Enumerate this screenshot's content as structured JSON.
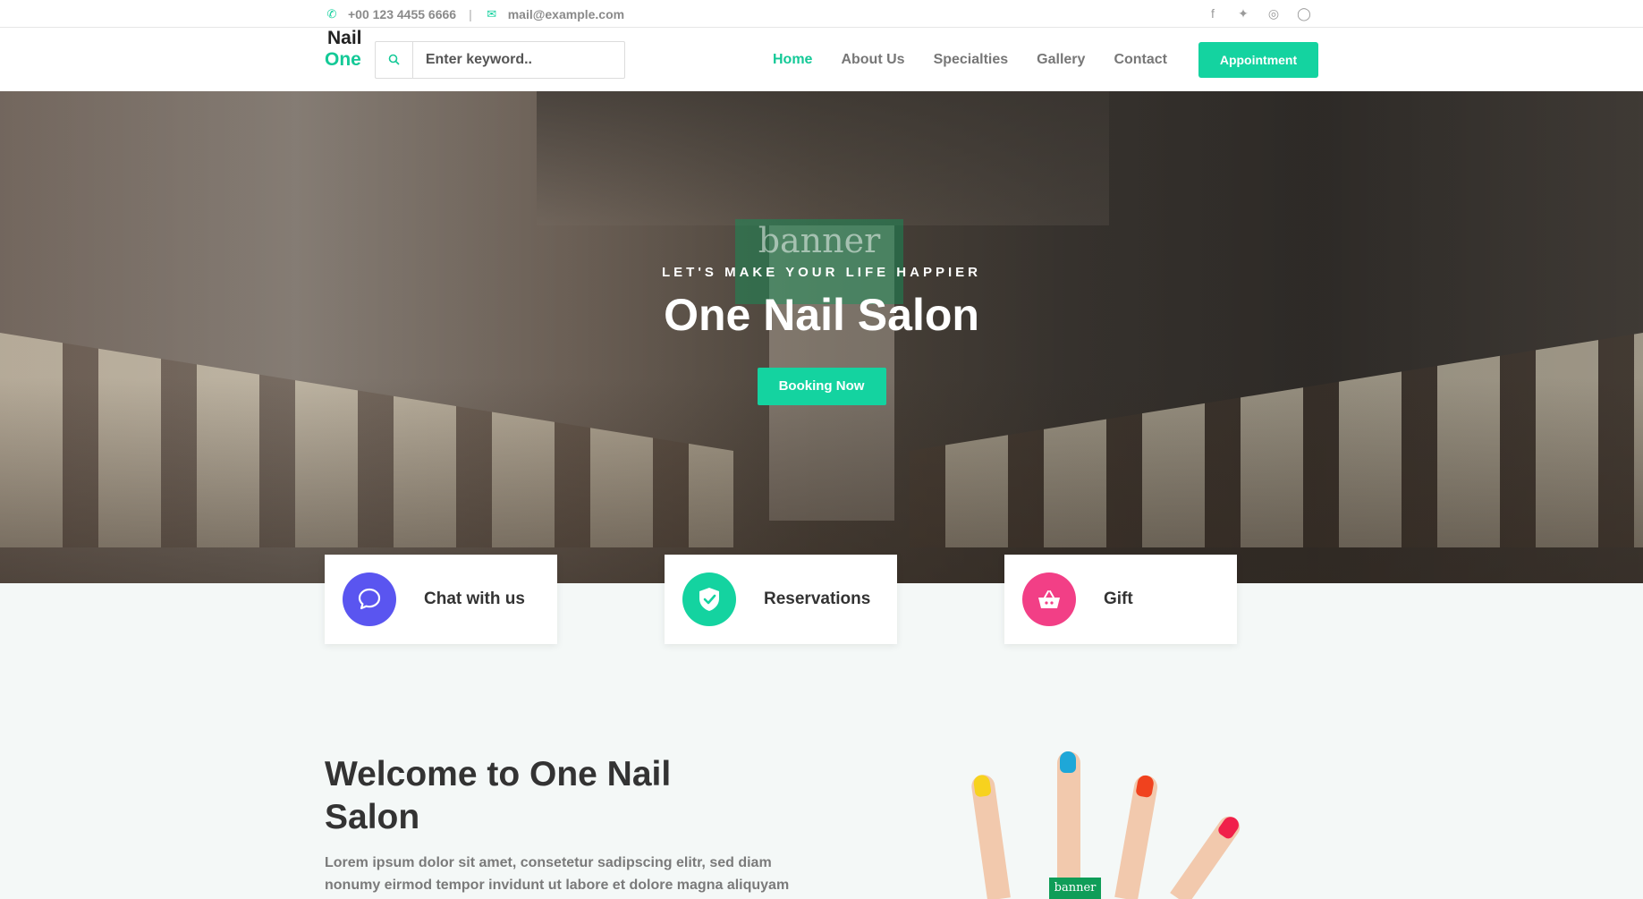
{
  "topbar": {
    "phone": "+00 123 4455 6666",
    "separator": "|",
    "email": "mail@example.com",
    "socials": [
      "facebook-icon",
      "twitter-icon",
      "dribbble-icon",
      "instagram-icon"
    ]
  },
  "nav": {
    "logo_one": "One",
    "logo_nail": "Nail",
    "search_placeholder": "Enter keyword..",
    "items": [
      {
        "label": "Home",
        "active": true
      },
      {
        "label": "About Us"
      },
      {
        "label": "Specialties"
      },
      {
        "label": "Gallery"
      },
      {
        "label": "Contact"
      }
    ],
    "cta": "Appointment"
  },
  "hero": {
    "badge": "banner",
    "tagline": "LET'S MAKE YOUR LIFE HAPPIER",
    "title": "One Nail Salon",
    "button": "Booking Now"
  },
  "features": [
    {
      "label": "Chat with us",
      "icon": "chat-icon",
      "color": "#5a55f0"
    },
    {
      "label": "Reservations",
      "icon": "shield-check-icon",
      "color": "#14d3a0"
    },
    {
      "label": "Gift",
      "icon": "basket-icon",
      "color": "#f23f86"
    }
  ],
  "welcome": {
    "title": "Welcome to One Nail Salon",
    "body": "Lorem ipsum dolor sit amet, consetetur sadipscing elitr, sed diam nonumy eirmod tempor invidunt ut labore et dolore magna aliquyam erat, sed diam voluptua. At vero eos et accusam et justo duo dolores et ea rebum."
  },
  "hand_image": {
    "tag": "banner",
    "nail_colors": [
      "#f7d21e",
      "#1ea7d8",
      "#f0421e",
      "#f0204a"
    ]
  },
  "colors": {
    "accent": "#14d3a0",
    "logo_green": "#14c997"
  }
}
